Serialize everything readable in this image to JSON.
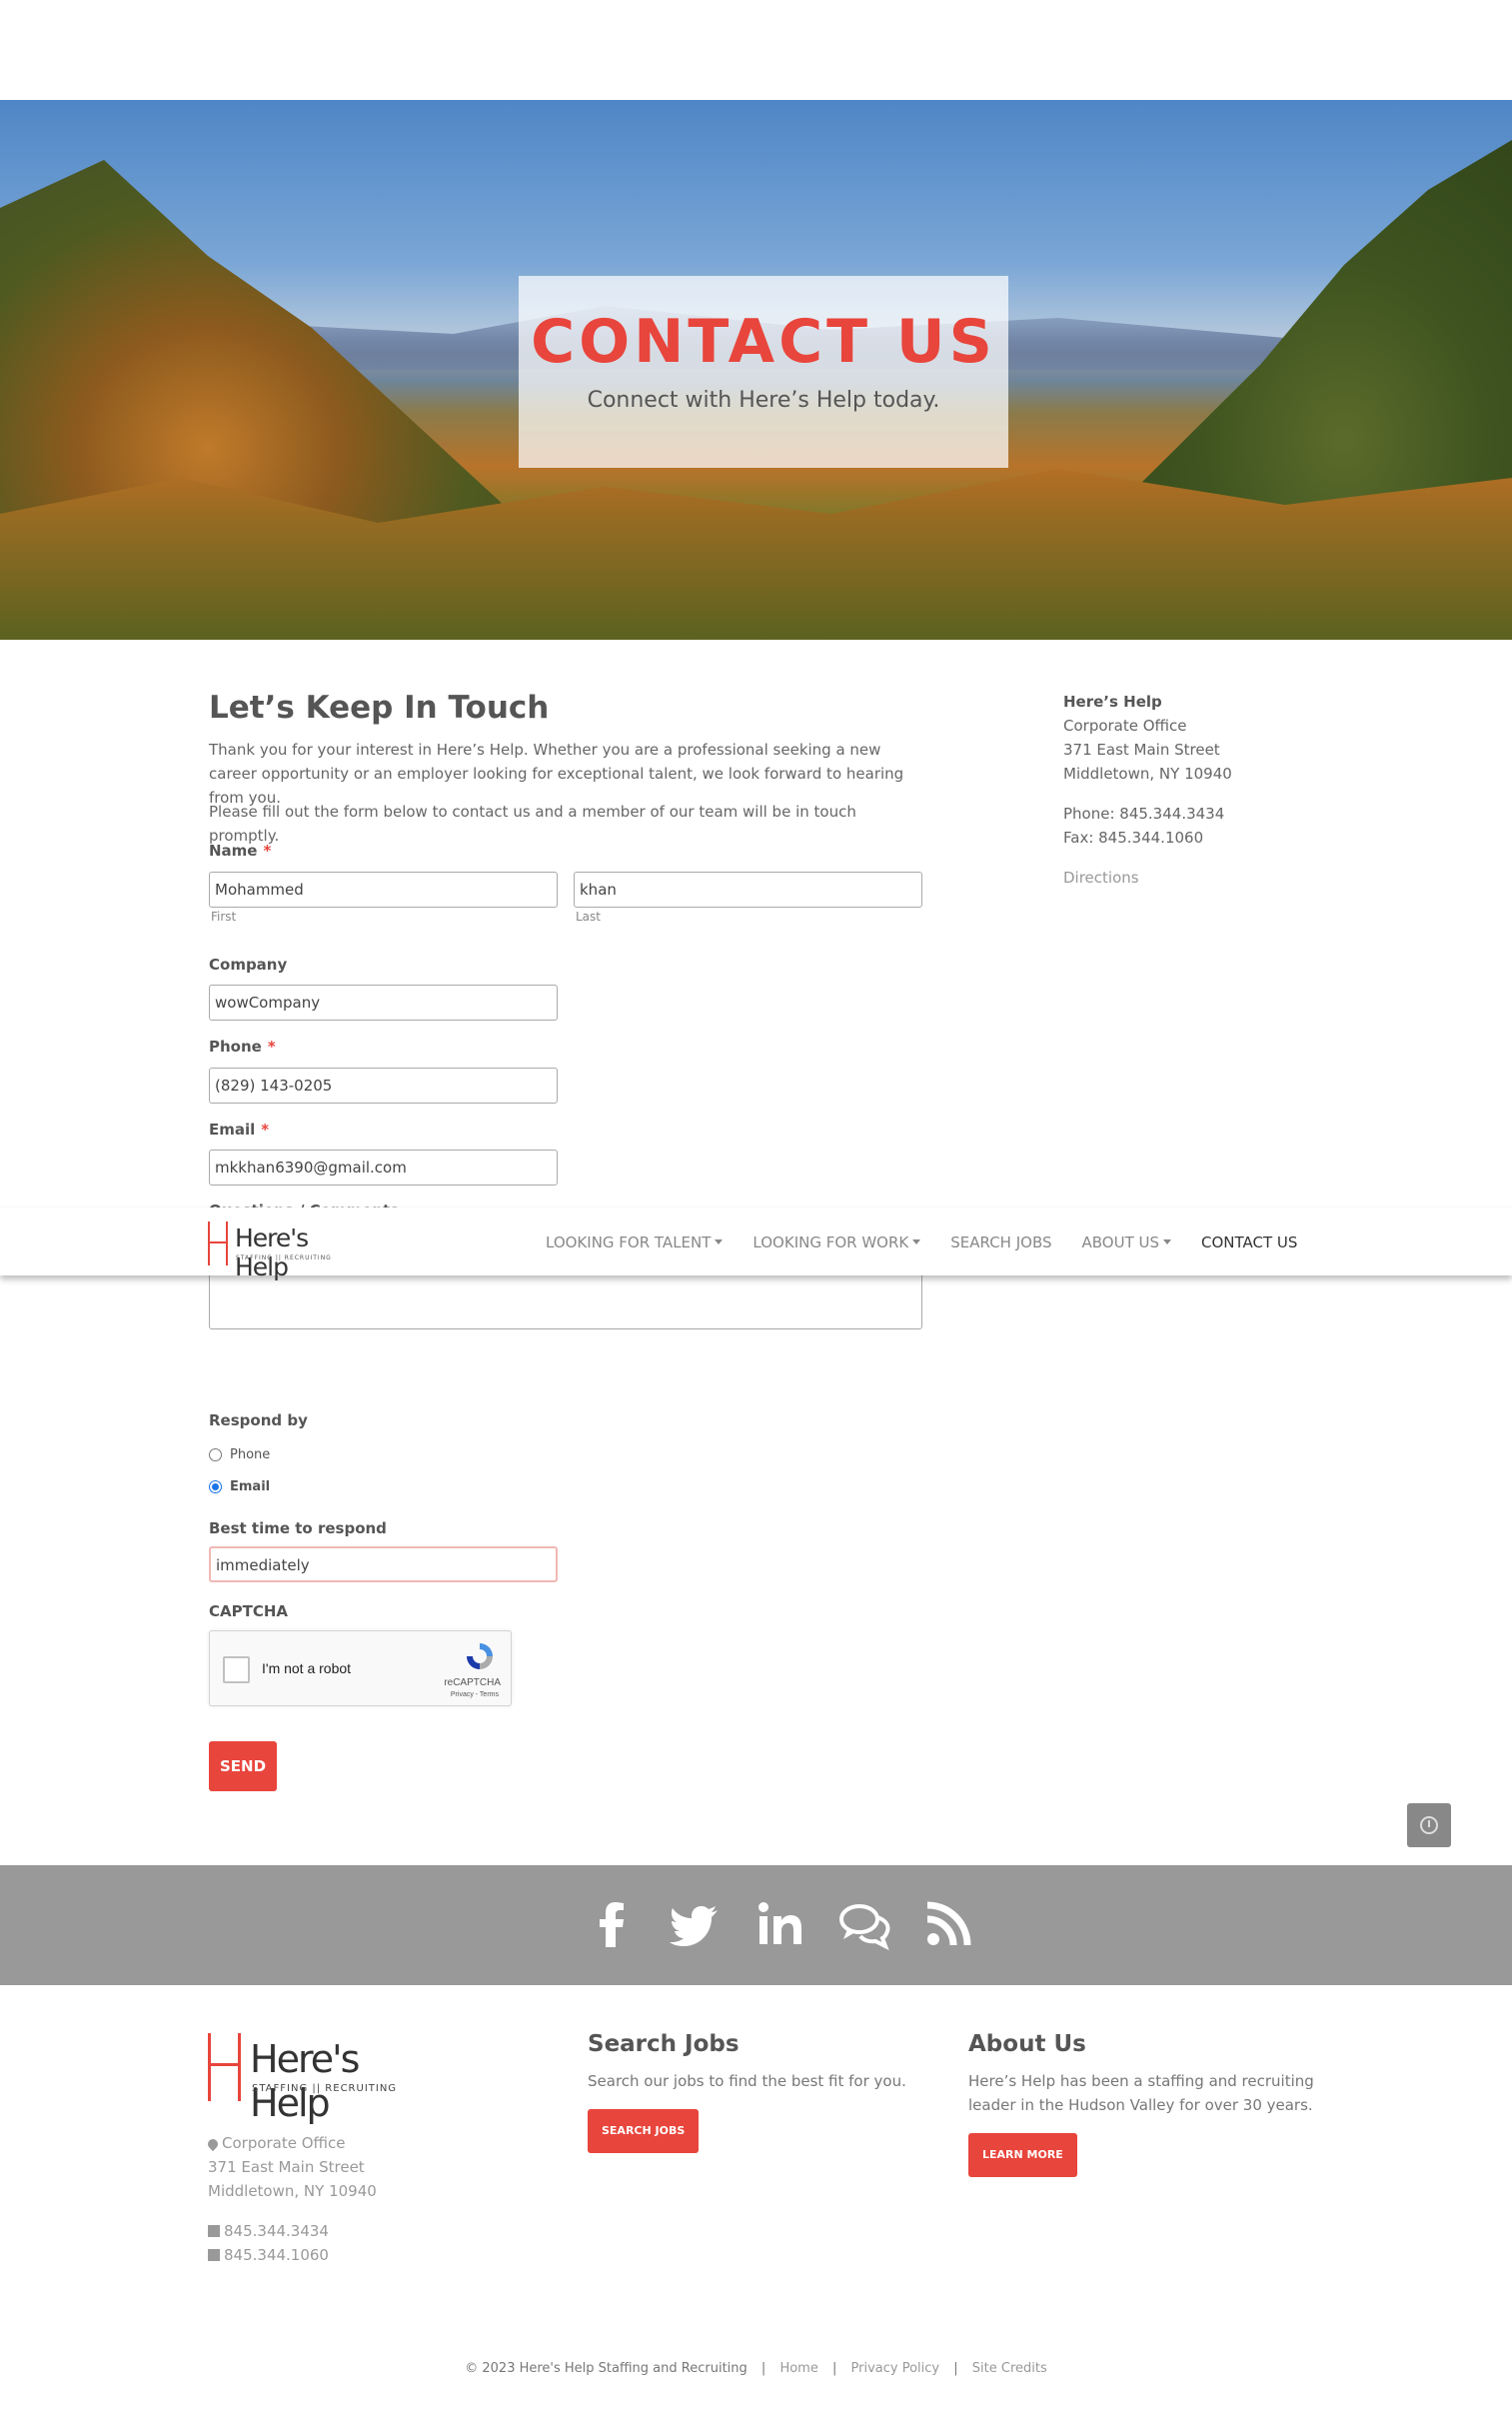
{
  "hero": {
    "title": "CONTACT US",
    "subtitle": "Connect with Here’s Help today."
  },
  "intro": {
    "heading": "Let’s Keep In Touch",
    "paragraph1": "Thank you for your interest in Here’s Help. Whether you are a professional seeking a new career opportunity or an employer looking for exceptional talent, we look forward to hearing from you.",
    "paragraph2": "Please fill out the form below to contact us and a member of our team will be in touch promptly."
  },
  "form": {
    "name_label": "Name",
    "required_mark": "*",
    "first_value": "Mohammed",
    "first_sublabel": "First",
    "last_value": "khan",
    "last_sublabel": "Last",
    "company_label": "Company",
    "company_value": "wowCompany",
    "phone_label": "Phone",
    "phone_value": "(829) 143-0205",
    "email_label": "Email",
    "email_value": "mkkhan6390@gmail.com",
    "comments_label": "Questions / Comments",
    "respond_label": "Respond by",
    "respond_options": [
      {
        "label": "Phone",
        "selected": false
      },
      {
        "label": "Email",
        "selected": true
      }
    ],
    "best_time_label": "Best time to respond",
    "best_time_value": "immediately",
    "captcha_label": "CAPTCHA",
    "captcha_text": "I'm not a robot",
    "captcha_brand": "reCAPTCHA",
    "captcha_links": "Privacy - Terms",
    "send_label": "SEND"
  },
  "office": {
    "name": "Here’s Help",
    "line1": "Corporate Office",
    "line2": "371 East Main Street",
    "line3": "Middletown, NY 10940",
    "phone": "Phone: 845.344.3434",
    "fax": "Fax: 845.344.1060",
    "directions": "Directions"
  },
  "nav": {
    "logo_word": "Here's Help",
    "logo_tag": "STAFFING || RECRUITING",
    "items": [
      {
        "label": "LOOKING FOR TALENT",
        "dropdown": true
      },
      {
        "label": "LOOKING FOR WORK",
        "dropdown": true
      },
      {
        "label": "SEARCH JOBS",
        "dropdown": false
      },
      {
        "label": "ABOUT US",
        "dropdown": true
      },
      {
        "label": "CONTACT US",
        "dropdown": false,
        "active": true
      }
    ]
  },
  "social": {
    "icons": [
      "facebook-icon",
      "twitter-icon",
      "linkedin-icon",
      "chat-icon",
      "rss-icon"
    ]
  },
  "footer": {
    "logo_word": "Here's Help",
    "logo_tag": "STAFFING || RECRUITING",
    "office": "Corporate Office",
    "street": "371 East Main Street",
    "city": "Middletown, NY 10940",
    "phone": "845.344.3434",
    "fax": "845.344.1060",
    "search_heading": "Search Jobs",
    "search_text": "Search our jobs to find the best fit for you.",
    "search_button": "SEARCH JOBS",
    "about_heading": "About Us",
    "about_text": "Here’s Help has been a staffing and recruiting leader in the Hudson Valley for over 30 years.",
    "about_button": "LEARN MORE",
    "copyright": "© 2023 Here's Help Staffing and Recruiting",
    "separator": "|",
    "links": [
      "Home",
      "Privacy Policy",
      "Site Credits"
    ]
  },
  "colors": {
    "accent": "#e8453c",
    "social_bar": "#999999"
  }
}
